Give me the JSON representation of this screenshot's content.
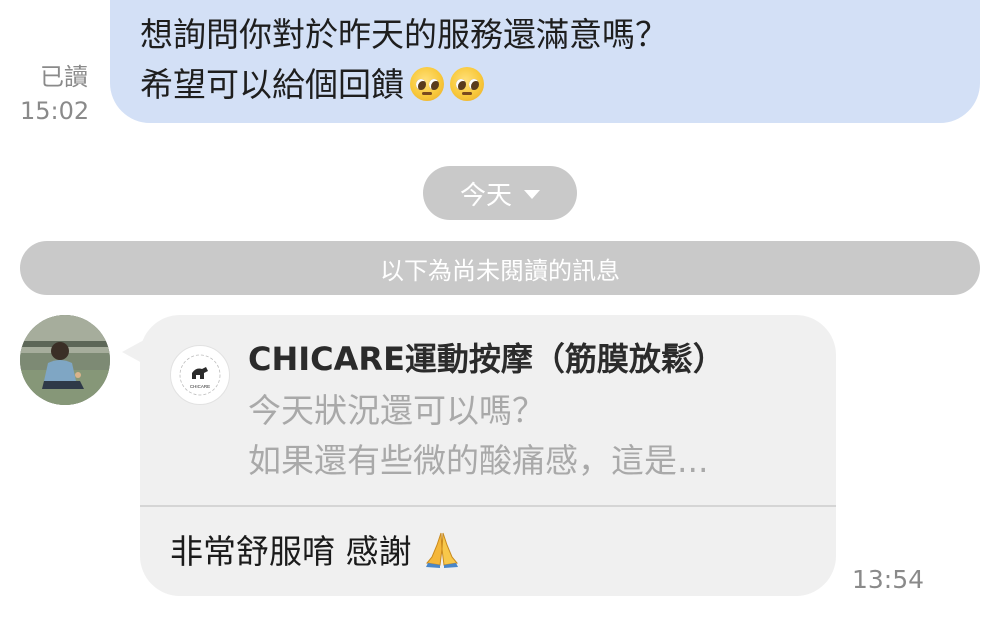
{
  "outgoing": {
    "lines": [
      "想詢問你對於昨天的服務還滿意嗎？",
      "希望可以給個回饋"
    ],
    "emoji": "pleading-face-icon"
  },
  "read_status": {
    "label": "已讀",
    "time": "15:02"
  },
  "date_divider": {
    "label": "今天"
  },
  "unread_divider": {
    "label": "以下為尚未閱讀的訊息"
  },
  "incoming": {
    "quote": {
      "sender": "CHICARE運動按摩（筋膜放鬆）",
      "logo_text": "CHICARE",
      "lines": [
        "今天狀況還可以嗎？",
        "如果還有些微的酸痛感，這是..."
      ]
    },
    "reply": "非常舒服唷 感謝",
    "reply_emoji": "folded-hands-icon",
    "time": "13:54"
  },
  "colors": {
    "outgoing_bubble": "#d3e0f6",
    "incoming_bubble": "#f0f0f0",
    "pill": "#c9c9c9"
  }
}
